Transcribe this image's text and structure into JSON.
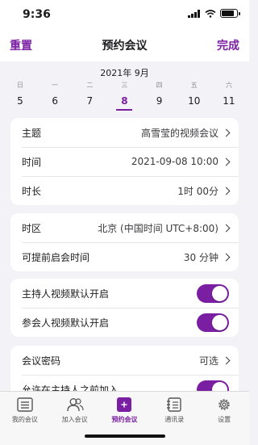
{
  "status_bar": {
    "time": "9:36"
  },
  "nav": {
    "reset": "重置",
    "title": "预约会议",
    "done": "完成"
  },
  "calendar": {
    "month_label": "2021年 9月",
    "weekdays": [
      "日",
      "一",
      "二",
      "三",
      "四",
      "五",
      "六"
    ],
    "days": [
      "5",
      "6",
      "7",
      "8",
      "9",
      "10",
      "11"
    ],
    "selected_day": "8"
  },
  "group1": {
    "topic": {
      "label": "主题",
      "value": "高雪莹的视频会议"
    },
    "time": {
      "label": "时间",
      "value": "2021-09-08 10:00"
    },
    "duration": {
      "label": "时长",
      "value": "1时 00分"
    }
  },
  "group2": {
    "timezone": {
      "label": "时区",
      "value": "北京 (中国时间 UTC+8:00)"
    },
    "early_join": {
      "label": "可提前启会时间",
      "value": "30 分钟"
    }
  },
  "group3": {
    "host_video": {
      "label": "主持人视频默认开启",
      "on": true
    },
    "participant_video": {
      "label": "参会人视频默认开启",
      "on": true
    }
  },
  "group4": {
    "password": {
      "label": "会议密码",
      "value": "可选"
    },
    "join_before_host": {
      "label": "允许在主持人之前加入",
      "on": true
    }
  },
  "tabbar": {
    "tabs": [
      {
        "label": "我的会议",
        "icon": "meeting-list-icon"
      },
      {
        "label": "加入会议",
        "icon": "people-icon"
      },
      {
        "label": "预约会议",
        "icon": "plus-icon"
      },
      {
        "label": "通讯录",
        "icon": "contacts-icon"
      },
      {
        "label": "设置",
        "icon": "gear-icon"
      }
    ],
    "active_index": 2
  },
  "colors": {
    "accent": "#7b1fa2",
    "background": "#f2f2f7"
  }
}
